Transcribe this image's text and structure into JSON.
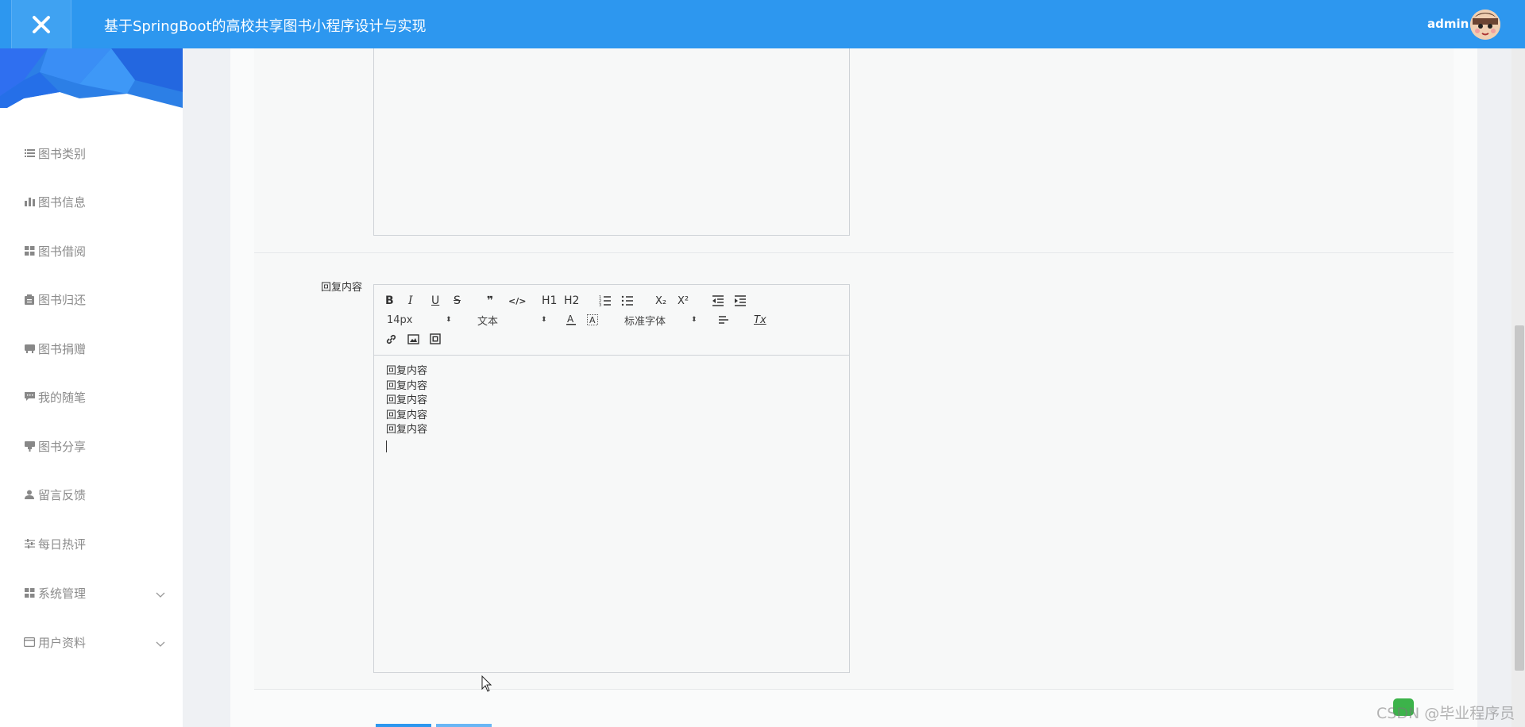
{
  "header": {
    "title": "基于SpringBoot的高校共享图书小程序设计与实现",
    "username": "admin",
    "accent": "#2d97ef"
  },
  "sidebar": {
    "items": [
      {
        "label": "图书类别",
        "icon": "list-icon"
      },
      {
        "label": "图书信息",
        "icon": "bar-chart-icon"
      },
      {
        "label": "图书借阅",
        "icon": "grid-icon"
      },
      {
        "label": "图书归还",
        "icon": "clipboard-icon"
      },
      {
        "label": "图书捐赠",
        "icon": "inbox-icon"
      },
      {
        "label": "我的随笔",
        "icon": "comment-icon"
      },
      {
        "label": "图书分享",
        "icon": "share-icon"
      },
      {
        "label": "留言反馈",
        "icon": "user-icon"
      },
      {
        "label": "每日热评",
        "icon": "sliders-icon"
      },
      {
        "label": "系统管理",
        "icon": "grid-icon",
        "expandable": true
      },
      {
        "label": "用户资料",
        "icon": "card-icon",
        "expandable": true
      }
    ]
  },
  "form": {
    "reply_label": "回复内容"
  },
  "editor": {
    "font_size": "14px",
    "block_format": "文本",
    "font_family": "标准字体",
    "buttons": {
      "bold": "B",
      "italic": "I",
      "underline": "U",
      "strike": "S",
      "quote": "❞",
      "code": "</>",
      "h1": "H1",
      "h2": "H2",
      "subscript": "X₂",
      "superscript": "X²",
      "clear_format": "Tx"
    },
    "content_lines": [
      "回复内容",
      "回复内容",
      "回复内容",
      "回复内容",
      "回复内容"
    ]
  },
  "watermark": "CSDN @毕业程序员"
}
